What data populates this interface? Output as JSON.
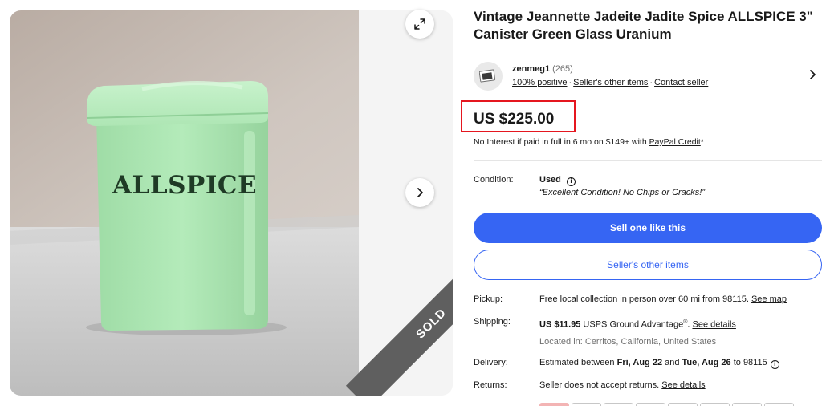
{
  "listing": {
    "title": "Vintage Jeannette Jadeite Jadite Spice ALLSPICE 3\" Canister Green Glass Uranium"
  },
  "gallery": {
    "label_text": "ALLSPICE",
    "sold_banner": "SOLD",
    "expand_icon": "expand-arrows-icon",
    "next_icon": "chevron-right-icon"
  },
  "seller": {
    "name": "zenmeg1",
    "count": "(265)",
    "positive": "100% positive",
    "other_items_link": "Seller's other items",
    "contact_link": "Contact seller"
  },
  "price": {
    "value": "US $225.00",
    "financing_prefix": "No Interest if paid in full in 6 mo on $149+ with ",
    "financing_link": "PayPal Credit",
    "financing_suffix": "*"
  },
  "condition": {
    "label": "Condition:",
    "value": "Used",
    "note": "“Excellent Condition! No Chips or Cracks!”"
  },
  "buttons": {
    "primary": "Sell one like this",
    "secondary": "Seller's other items"
  },
  "pickup": {
    "label": "Pickup:",
    "text": "Free local collection in person over 60 mi from 98115. ",
    "link": "See map"
  },
  "shipping": {
    "label": "Shipping:",
    "cost": "US $11.95",
    "service": " USPS Ground Advantage",
    "reg": "®",
    "sep": ". ",
    "link": "See details",
    "location": "Located in: Cerritos, California, United States"
  },
  "delivery": {
    "label": "Delivery:",
    "prefix": "Estimated between ",
    "start": "Fri, Aug 22",
    "and": " and ",
    "end": "Tue, Aug 26",
    "suffix": " to 98115"
  },
  "returns": {
    "label": "Returns:",
    "text": "Seller does not accept returns. ",
    "link": "See details"
  },
  "colors": {
    "accent_blue": "#3665f3",
    "highlight_red": "#e5161f",
    "jade_green": "#a6e3ad"
  }
}
